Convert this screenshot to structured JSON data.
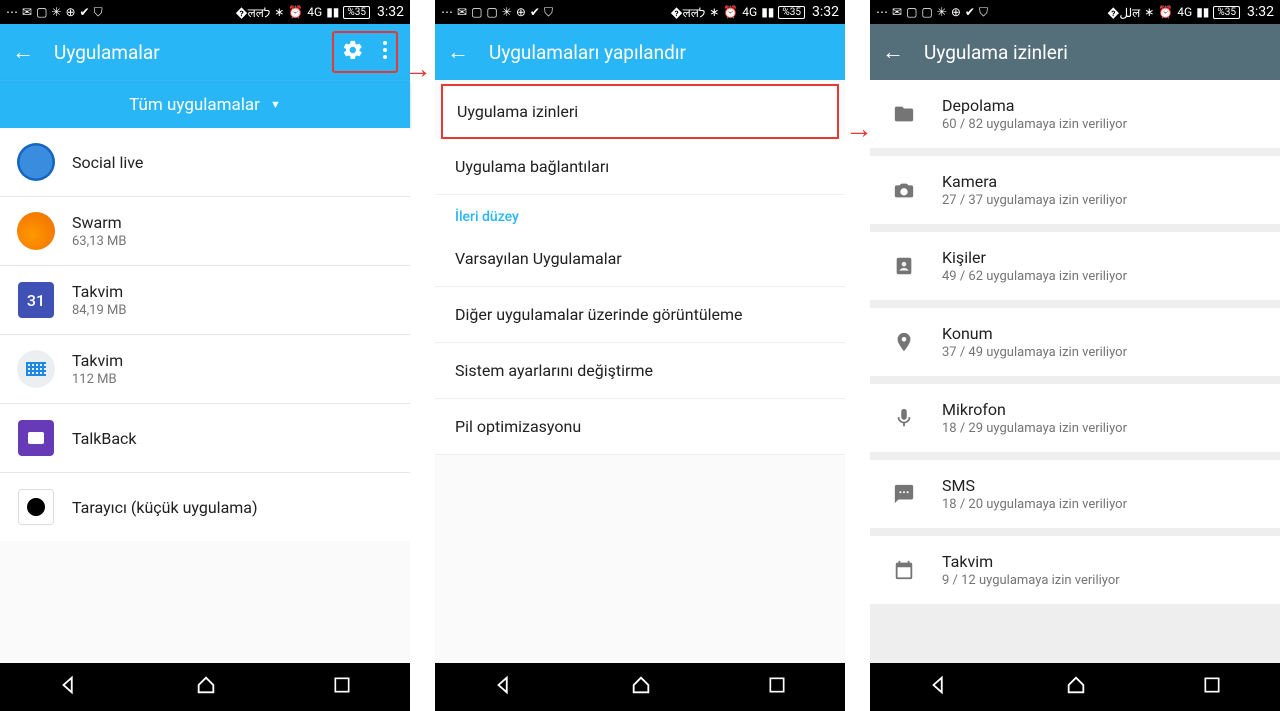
{
  "status": {
    "battery": "%35",
    "time": "3:32"
  },
  "arrows": {
    "a1": "→",
    "a2": "→"
  },
  "screen1": {
    "title": "Uygulamalar",
    "filter": "Tüm uygulamalar",
    "apps": [
      {
        "name": "Social live",
        "sub": ""
      },
      {
        "name": "Swarm",
        "sub": "63,13 MB"
      },
      {
        "name": "Takvim",
        "sub": "84,19 MB"
      },
      {
        "name": "Takvim",
        "sub": "112 MB"
      },
      {
        "name": "TalkBack",
        "sub": ""
      },
      {
        "name": "Tarayıcı (küçük uygulama)",
        "sub": ""
      }
    ],
    "cal31": "31"
  },
  "screen2": {
    "title": "Uygulamaları yapılandır",
    "items": {
      "perm": "Uygulama izinleri",
      "links": "Uygulama bağlantıları",
      "section": "İleri düzey",
      "default": "Varsayılan Uygulamalar",
      "overlay": "Diğer uygulamalar üzerinde görüntüleme",
      "modify": "Sistem ayarlarını değiştirme",
      "battery": "Pil optimizasyonu"
    }
  },
  "screen3": {
    "title": "Uygulama izinleri",
    "perms": [
      {
        "name": "Depolama",
        "sub": "60 / 82 uygulamaya izin veriliyor",
        "icon": "folder"
      },
      {
        "name": "Kamera",
        "sub": "27 / 37 uygulamaya izin veriliyor",
        "icon": "camera"
      },
      {
        "name": "Kişiler",
        "sub": "49 / 62 uygulamaya izin veriliyor",
        "icon": "contacts"
      },
      {
        "name": "Konum",
        "sub": "37 / 49 uygulamaya izin veriliyor",
        "icon": "location"
      },
      {
        "name": "Mikrofon",
        "sub": "18 / 29 uygulamaya izin veriliyor",
        "icon": "mic"
      },
      {
        "name": "SMS",
        "sub": "18 / 20 uygulamaya izin veriliyor",
        "icon": "sms"
      },
      {
        "name": "Takvim",
        "sub": "9 / 12 uygulamaya izin veriliyor",
        "icon": "calendar"
      }
    ]
  }
}
